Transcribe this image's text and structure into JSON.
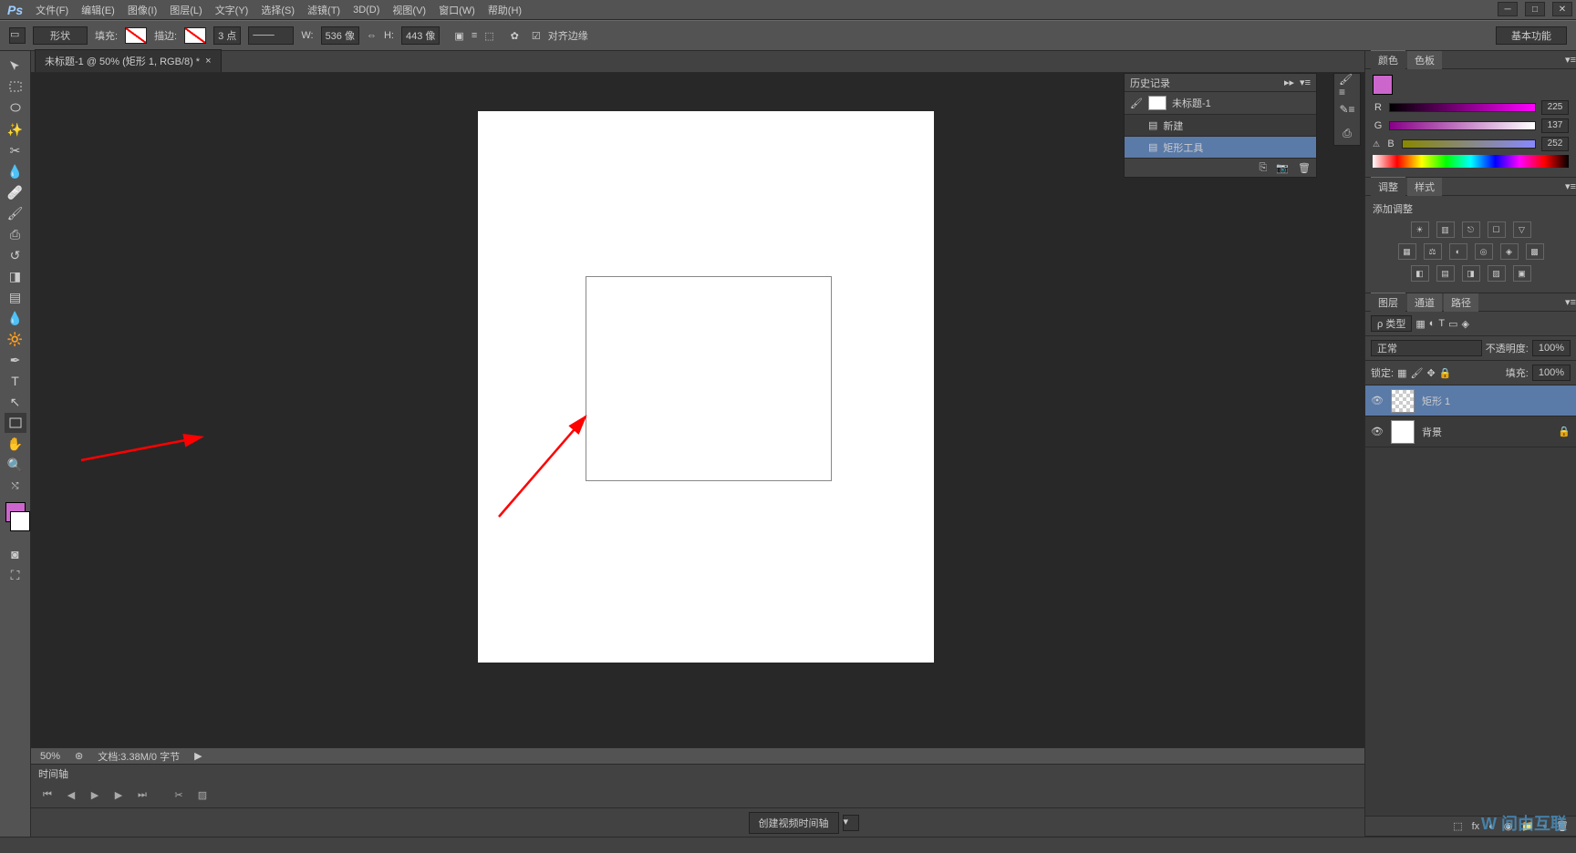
{
  "menu": [
    "文件(F)",
    "编辑(E)",
    "图像(I)",
    "图层(L)",
    "文字(Y)",
    "选择(S)",
    "滤镜(T)",
    "3D(D)",
    "视图(V)",
    "窗口(W)",
    "帮助(H)"
  ],
  "optbar": {
    "shape_mode": "形状",
    "fill_label": "填充:",
    "stroke_label": "描边:",
    "stroke_pt": "3 点",
    "w_label": "W:",
    "w_val": "536 像",
    "h_label": "H:",
    "h_val": "443 像",
    "align_label": "对齐边缘",
    "workspace": "基本功能"
  },
  "tab": {
    "title": "未标题-1 @ 50% (矩形 1, RGB/8) *"
  },
  "status": {
    "zoom": "50%",
    "doc": "文档:3.38M/0 字节"
  },
  "timeline": {
    "title": "时间轴",
    "create": "创建视频时间轴"
  },
  "history": {
    "title": "历史记录",
    "doc": "未标题-1",
    "items": [
      "新建",
      "矩形工具"
    ]
  },
  "color": {
    "tab1": "颜色",
    "tab2": "色板",
    "r": "R",
    "g": "G",
    "b": "B",
    "rval": "225",
    "gval": "137",
    "bval": "252"
  },
  "adjust": {
    "tab1": "调整",
    "tab2": "样式",
    "add": "添加调整"
  },
  "layers": {
    "tab1": "图层",
    "tab2": "通道",
    "tab3": "路径",
    "kind": "ρ 类型",
    "blend": "正常",
    "opacity_label": "不透明度:",
    "opacity": "100%",
    "lock_label": "锁定:",
    "fill_label": "填充:",
    "fill_val": "100%",
    "layer1": "矩形 1",
    "layer2": "背景"
  },
  "watermark": "W 问由互联"
}
